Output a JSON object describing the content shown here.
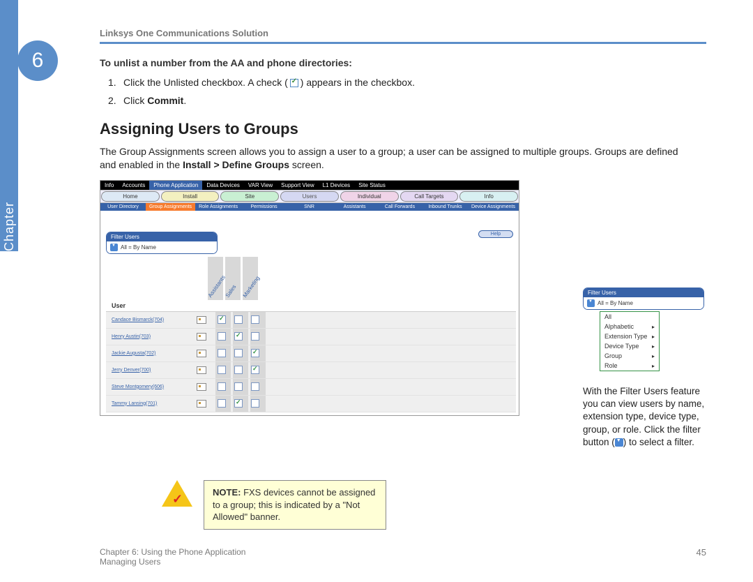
{
  "meta": {
    "header": "Linksys One Communications Solution",
    "chapter_number": "6",
    "chapter_label": "Chapter"
  },
  "intro": {
    "subheading": "To unlist a number from the AA and phone directories:",
    "step1_pre": "Click the Unlisted checkbox. A check (",
    "step1_post": ") appears in the checkbox.",
    "step2_pre": "Click ",
    "step2_bold": "Commit",
    "step2_post": "."
  },
  "section": {
    "heading": "Assigning Users to Groups",
    "para_pre": "The Group Assignments screen allows you to assign a user to a group; a user can be assigned to multiple groups. Groups are defined and enabled in the ",
    "para_bold": "Install > Define Groups",
    "para_post": " screen."
  },
  "screenshot": {
    "top_tabs": [
      "Info",
      "Accounts",
      "Phone Application",
      "Data Devices",
      "VAR View",
      "Support View",
      "L1 Devices",
      "Site Status"
    ],
    "top_active": 2,
    "row2": [
      "Home",
      "Install",
      "Site",
      "Users",
      "Individual",
      "Call Targets",
      "Info"
    ],
    "row3": [
      "User Directory",
      "Group Assignments",
      "Role Assignments",
      "Permissions",
      "SNR",
      "Assistants",
      "Call Forwards",
      "Inbound Trunks",
      "Device Assignments"
    ],
    "row3_active": 1,
    "help": "Help",
    "filter": {
      "title": "Filter Users",
      "value": "All = By Name"
    },
    "groups": [
      "Assistants",
      "Sales",
      "Marketing"
    ],
    "user_label": "User",
    "users": [
      {
        "name": "Candace Bismarck(704)",
        "checks": [
          true,
          false,
          false
        ]
      },
      {
        "name": "Henry Austin(703)",
        "checks": [
          false,
          true,
          false
        ]
      },
      {
        "name": "Jackie Augusta(702)",
        "checks": [
          false,
          false,
          true
        ]
      },
      {
        "name": "Jerry Denver(700)",
        "checks": [
          false,
          false,
          true
        ]
      },
      {
        "name": "Steve Montgomery(606)",
        "checks": [
          false,
          false,
          false
        ]
      },
      {
        "name": "Tammy Lansing(701)",
        "checks": [
          false,
          true,
          false
        ]
      }
    ]
  },
  "side_filter": {
    "title": "Filter Users",
    "value": "All = By Name",
    "menu": [
      "All",
      "Alphabetic",
      "Extension Type",
      "Device Type",
      "Group",
      "Role"
    ]
  },
  "side_caption": {
    "pre": "With the Filter Users feature you can view users by name, extension type, device type, group, or role. Click the filter button (",
    "post": ") to select a filter."
  },
  "note": {
    "label": "NOTE:",
    "text": " FXS devices cannot be assigned to a group; this is indicated by a \"Not Allowed\" banner."
  },
  "footer": {
    "line1": "Chapter 6: Using the Phone Application",
    "line2": "Managing Users",
    "page": "45"
  }
}
